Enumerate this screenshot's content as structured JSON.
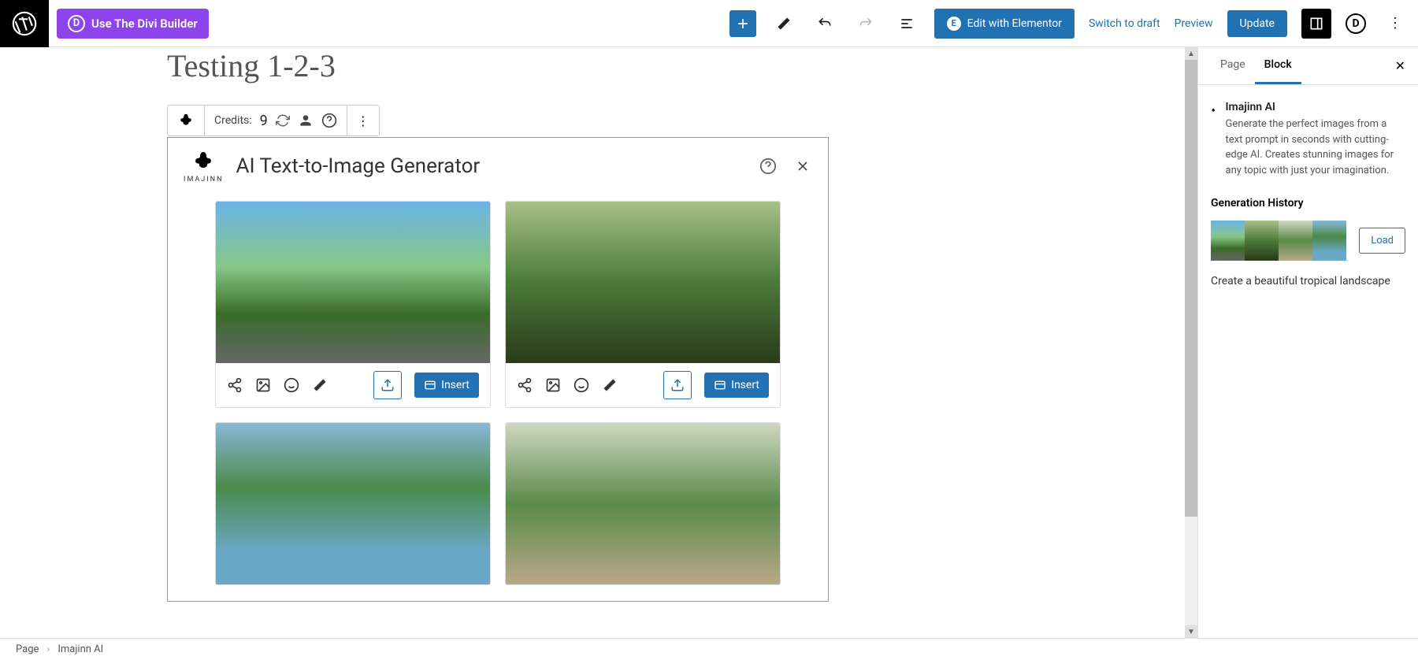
{
  "topbar": {
    "divi_button": "Use The Divi Builder",
    "elementor_button": "Edit with Elementor",
    "switch_draft": "Switch to draft",
    "preview": "Preview",
    "update": "Update"
  },
  "page": {
    "title": "Testing 1-2-3"
  },
  "block_toolbar": {
    "credits_label": "Credits:",
    "credits_value": "9"
  },
  "generator": {
    "brand": "IMAJINN",
    "title": "AI Text-to-Image Generator",
    "insert_label": "Insert"
  },
  "sidebar": {
    "tabs": {
      "page": "Page",
      "block": "Block"
    },
    "block_name": "Imajinn AI",
    "block_desc": "Generate the perfect images from a text prompt in seconds with cutting-edge AI. Creates stunning images for any topic with just your imagination.",
    "history_title": "Generation History",
    "load_button": "Load",
    "prompt_text": "Create a beautiful tropical landscape"
  },
  "footer": {
    "crumb1": "Page",
    "crumb2": "Imajinn AI"
  }
}
